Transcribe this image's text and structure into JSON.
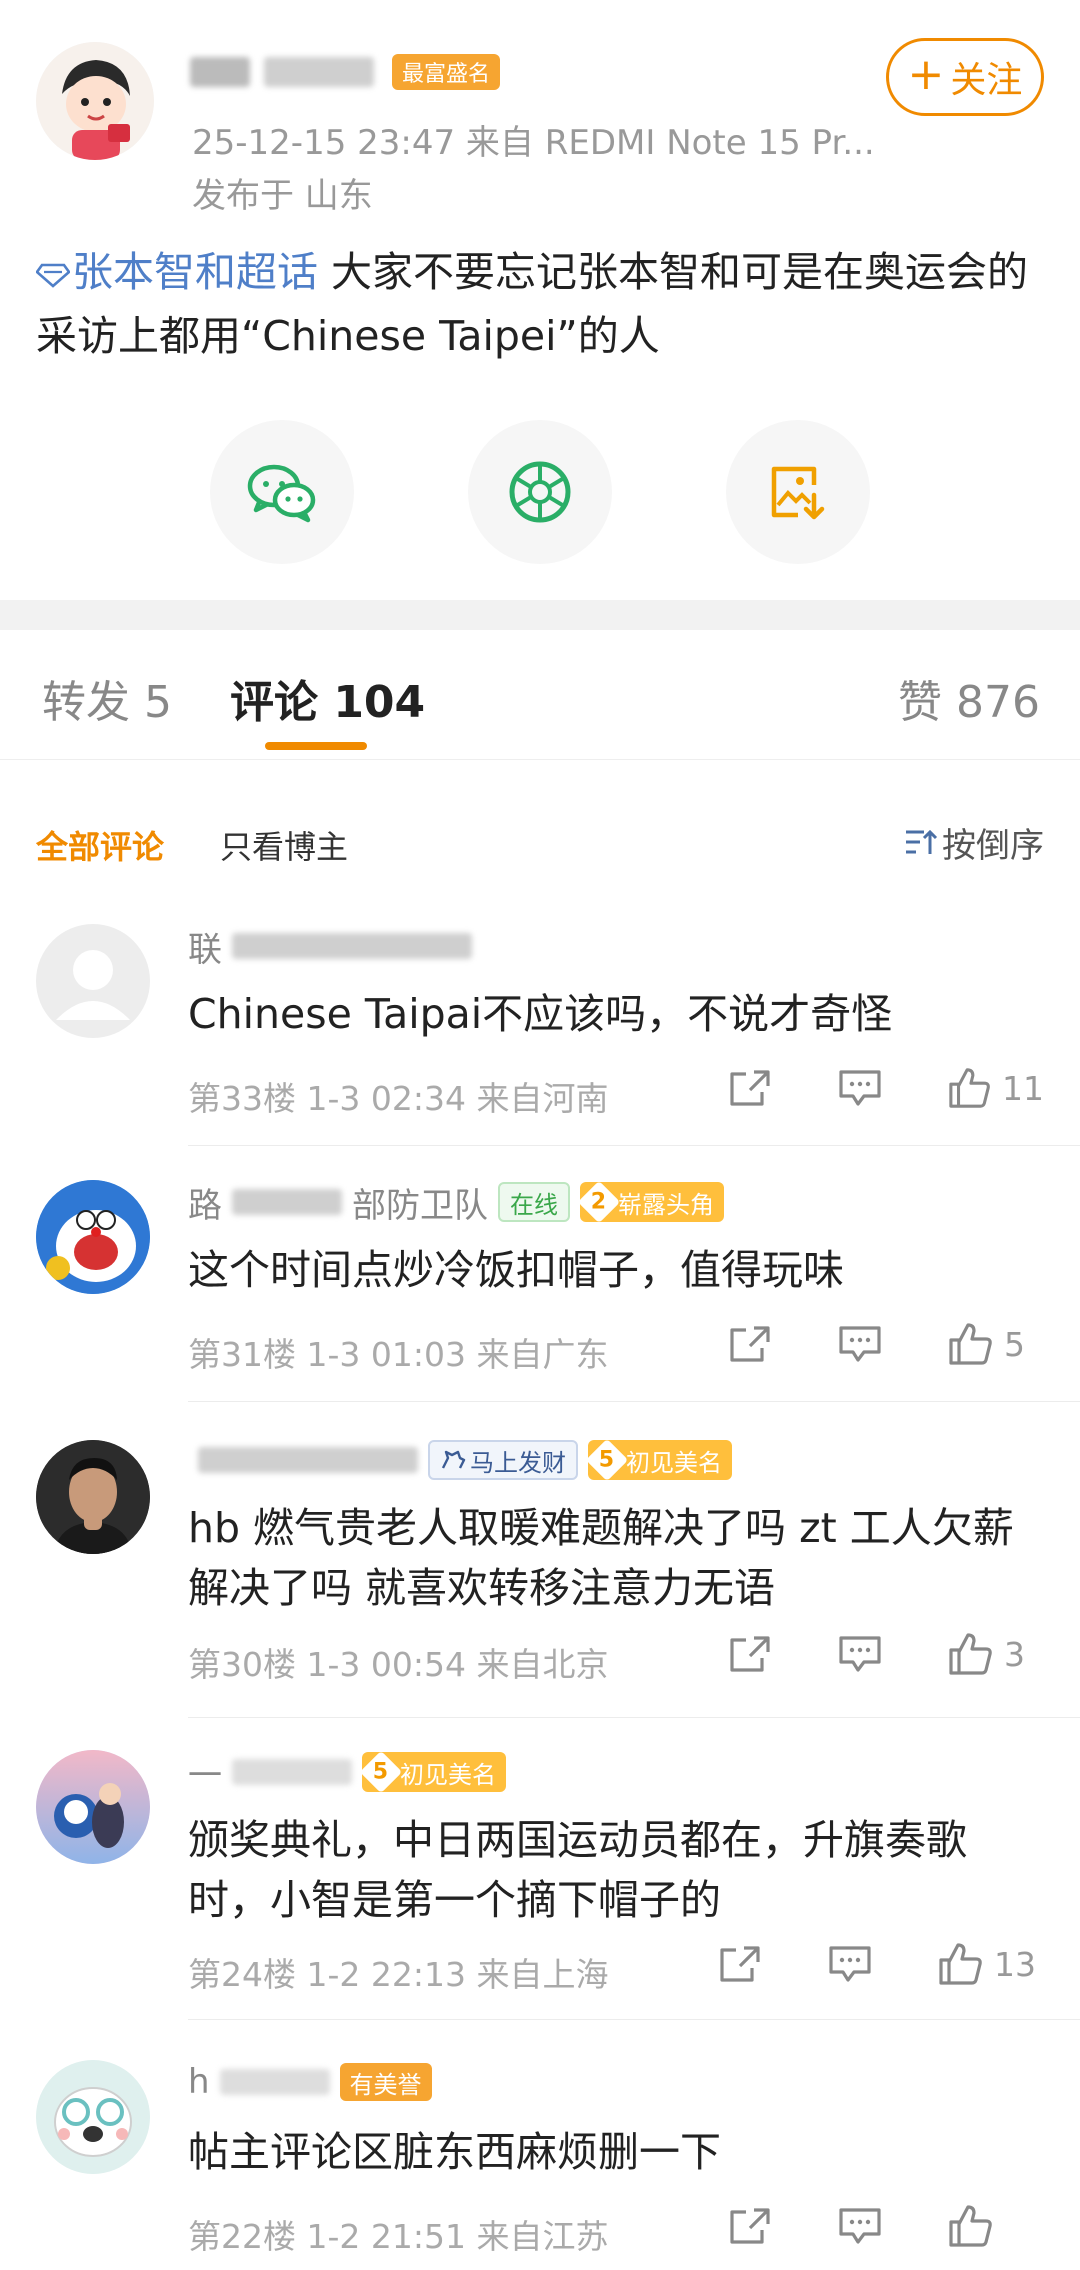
{
  "post": {
    "badge": "最富盛名",
    "meta_line": "25-12-15 23:47  来自 REDMI Note 15 Pr...",
    "location": "发布于 山东",
    "follow_label": "关注",
    "topic": "张本智和超话",
    "body": " 大家不要忘记张本智和可是在奥运会的采访上都用“Chinese Taipei”的人"
  },
  "share": {
    "icons": [
      "wechat-icon",
      "moments-icon",
      "save-image-icon"
    ],
    "colors": {
      "wechat": "#2aae67",
      "moments": "#2aae67",
      "save": "#f0a000"
    }
  },
  "tabs": {
    "repost": "转发 5",
    "comments": "评论 104",
    "likes": "赞 876"
  },
  "filter": {
    "all": "全部评论",
    "owner_only": "只看博主",
    "sort": "按倒序"
  },
  "accent_color": "#f08a00",
  "comments": [
    {
      "username": "联",
      "text": "Chinese Taipai不应该吗，不说才奇怪",
      "meta": "第33楼 1-3 02:34  来自河南",
      "likes": "11"
    },
    {
      "username": "路",
      "username_tail": "部防卫队",
      "online": "在线",
      "level": "2",
      "level_label": "崭露头角",
      "text": "这个时间点炒冷饭扣帽子，值得玩味",
      "meta": "第31楼 1-3 01:03  来自广东",
      "likes": "5"
    },
    {
      "username": "",
      "fortune": "马上发财",
      "level": "5",
      "level_label": "初见美名",
      "text": "hb 燃气贵老人取暖难题解决了吗 zt 工人欠薪解决了吗 就喜欢转移注意力无语",
      "meta": "第30楼 1-3 00:54  来自北京",
      "likes": "3"
    },
    {
      "username": "一",
      "level": "5",
      "level_label": "初见美名",
      "text": "颁奖典礼，中日两国运动员都在，升旗奏歌时，小智是第一个摘下帽子的",
      "meta": "第24楼 1-2 22:13  来自上海",
      "likes": "13"
    },
    {
      "username": "h",
      "badge": "有美誉",
      "text": "帖主评论区脏东西麻烦删一下",
      "meta": "第22楼 1-2 21:51  来自江苏",
      "likes": ""
    }
  ]
}
